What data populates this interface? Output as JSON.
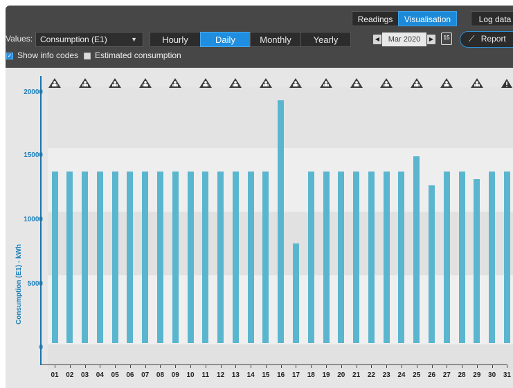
{
  "top_tabs": [
    {
      "label": "Readings",
      "active": false
    },
    {
      "label": "Visualisation",
      "active": true
    },
    {
      "label": "Log data",
      "active": false
    }
  ],
  "toolbar": {
    "values_label": "Values:",
    "values_select": "Consumption (E1)",
    "periods": [
      {
        "label": "Hourly",
        "active": false
      },
      {
        "label": "Daily",
        "active": true
      },
      {
        "label": "Monthly",
        "active": false
      },
      {
        "label": "Yearly",
        "active": false
      }
    ],
    "date": "Mar 2020",
    "calendar_day": "15",
    "report_label": "Report"
  },
  "options": {
    "show_info_codes": {
      "label": "Show info codes",
      "checked": true
    },
    "estimated_consumption": {
      "label": "Estimated consumption",
      "checked": false
    }
  },
  "icons": {
    "info_code": "person-warning-icon",
    "warning": "warning-triangle-icon",
    "calendar": "calendar-icon",
    "report": "line-chart-icon"
  },
  "colors": {
    "bar": "#5ab6cf",
    "accent": "#1f8de0",
    "axis_label": "#1c7fb8"
  },
  "chart_data": {
    "type": "bar",
    "ylabel": "Consumption (E1) - kWh",
    "ylim": [
      0,
      20000
    ],
    "yticks": [
      "0",
      "5000",
      "10000",
      "15000",
      "20000"
    ],
    "categories": [
      "01",
      "02",
      "03",
      "04",
      "05",
      "06",
      "07",
      "08",
      "09",
      "10",
      "11",
      "12",
      "13",
      "14",
      "15",
      "16",
      "17",
      "18",
      "19",
      "20",
      "21",
      "22",
      "23",
      "24",
      "25",
      "26",
      "27",
      "28",
      "29",
      "30",
      "31"
    ],
    "values": [
      13400,
      13400,
      13400,
      13400,
      13400,
      13400,
      13400,
      13400,
      13400,
      13400,
      13400,
      13400,
      13400,
      13400,
      13400,
      19000,
      7800,
      13400,
      13400,
      13400,
      13400,
      13400,
      13400,
      13400,
      14600,
      12300,
      13400,
      13400,
      12800,
      13400,
      13400
    ],
    "info_code_days": [
      "01",
      "03",
      "05",
      "07",
      "09",
      "11",
      "13",
      "15",
      "17",
      "19",
      "21",
      "23",
      "25",
      "27",
      "29"
    ],
    "warning_days": [
      "31"
    ]
  }
}
